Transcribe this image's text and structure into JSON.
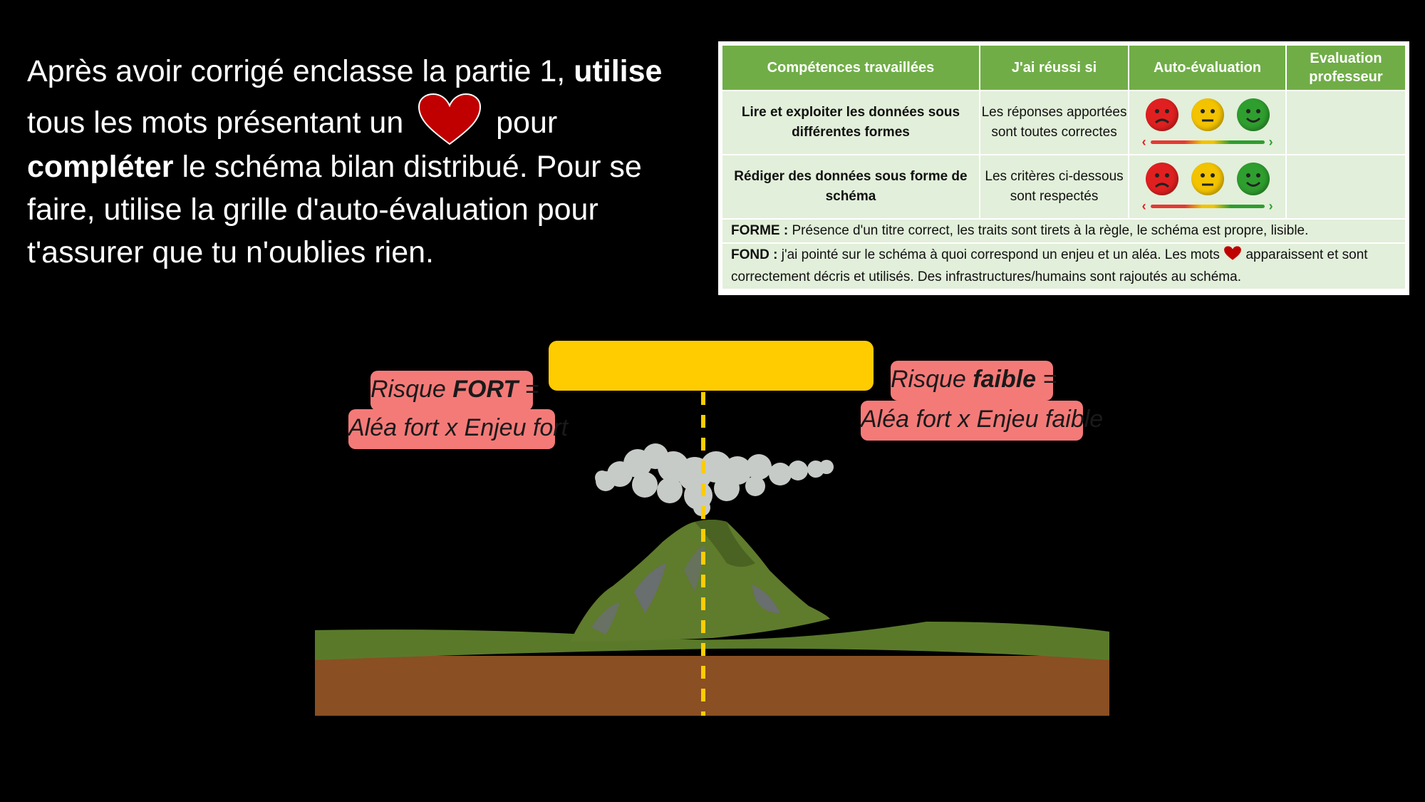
{
  "instructions": {
    "part1": "Après avoir corrigé enclasse la partie 1, ",
    "bold1": "utilise",
    "part2": " tous les mots présentant un ",
    "part3": " pour ",
    "bold2": "compléter",
    "part4": " le schéma bilan distribué. Pour se faire, utilise la grille d'auto-évaluation pour t'assurer que tu n'oublies rien."
  },
  "evaluation_table": {
    "headers": [
      "Compétences travaillées",
      "J'ai réussi si",
      "Auto-évaluation",
      "Evaluation professeur"
    ],
    "rows": [
      {
        "competence": "Lire et exploiter les données sous différentes formes",
        "criteria": "Les réponses apportées sont toutes correctes"
      },
      {
        "competence": "Rédiger des données sous forme de schéma",
        "criteria": "Les critères ci-dessous sont respectés"
      }
    ],
    "forme_label": "FORME :",
    "forme_text": " Présence d'un titre correct, les traits sont tirets à la règle, le schéma est propre, lisible.",
    "fond_label": "FOND :",
    "fond_text_1": " j'ai pointé sur le schéma à quoi correspond un enjeu et un aléa. Les mots ",
    "fond_text_2": " apparaissent et sont correctement décris et utilisés. Des infrastructures/humains sont rajoutés au schéma.",
    "arrow_left": "‹",
    "arrow_right": "›"
  },
  "diagram": {
    "risk_fort_prefix": "Risque ",
    "risk_fort_bold": "FORT",
    "risk_fort_suffix": " =",
    "risk_fort_formula": "Aléa fort x Enjeu fort",
    "risk_faible_prefix": "Risque ",
    "risk_faible_bold": "faible",
    "risk_faible_suffix": " =",
    "risk_faible_formula": "Aléa fort x Enjeu faible"
  },
  "colors": {
    "table_header": "#70ad47",
    "table_cell": "#e2efda",
    "title_box": "#ffcc00",
    "risk_label": "#f47a78",
    "heart": "#c00000",
    "dashed_line": "#ffcc00",
    "grass": "#5a7a2a",
    "soil": "#8a4f22",
    "face_red": "#e02020",
    "face_yellow": "#f3c300",
    "face_green": "#2e9e2e"
  },
  "icons": [
    "heart-icon",
    "sad-face-icon",
    "neutral-face-icon",
    "happy-face-icon",
    "volcano-illustration",
    "smoke-cloud"
  ]
}
